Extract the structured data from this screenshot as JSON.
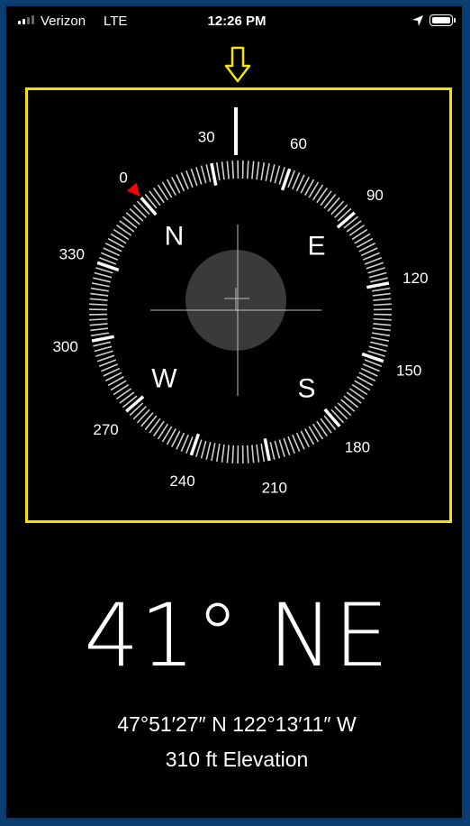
{
  "status_bar": {
    "carrier": "Verizon",
    "network": "LTE",
    "time": "12:26 PM",
    "signal_bars_on": 2,
    "signal_bars_total": 4,
    "battery_level": 1.0,
    "icons": [
      "signal-icon",
      "location-arrow-icon",
      "battery-icon"
    ]
  },
  "compass": {
    "bezel_numbers": [
      "0",
      "30",
      "60",
      "90",
      "120",
      "150",
      "180",
      "210",
      "240",
      "270",
      "300",
      "330"
    ],
    "cardinals": {
      "n": "N",
      "e": "E",
      "s": "S",
      "w": "W"
    },
    "rotation_deg": 41,
    "heading_marker_color": "#ff0000",
    "highlight_color": "#f7e300"
  },
  "readout": {
    "heading": "41° NE",
    "coordinates": "47°51′27″ N  122°13′11″ W",
    "elevation": "310 ft Elevation"
  }
}
